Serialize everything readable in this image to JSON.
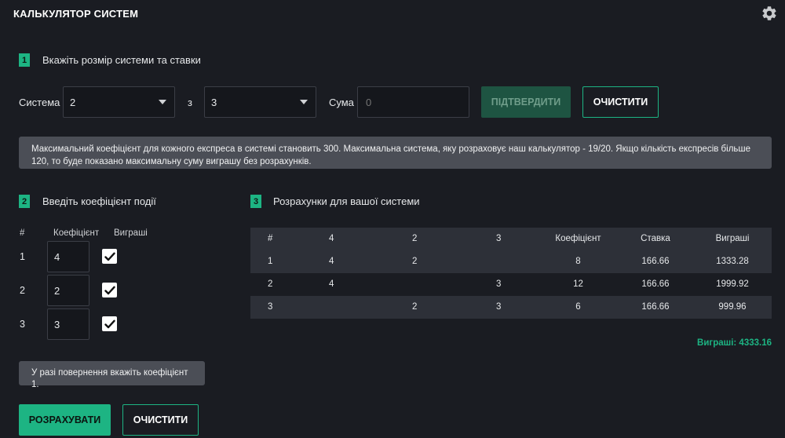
{
  "header": {
    "title": "КАЛЬКУЛЯТОР СИСТЕМ",
    "settings_icon": "gear-icon"
  },
  "step1": {
    "number": "1",
    "label": "Вкажіть розмір системи та ставки",
    "system_label": "Система",
    "system_value": "2",
    "of_label": "з",
    "of_value": "3",
    "sum_label": "Сума",
    "sum_placeholder": "0",
    "confirm_label": "ПІДТВЕРДИТИ",
    "clear_label": "ОЧИСТИТИ"
  },
  "info_note": "Максимальний коефіцієнт для кожного експреса в системі становить 300. Максимальна система, яку розраховує наш калькулятор - 19/20. Якщо кількість експресів більше 120, то буде показано максимальну суму виграшу без розрахунків.",
  "step2": {
    "number": "2",
    "label": "Введіть коефіцієнт події",
    "columns": {
      "num": "#",
      "coef": "Коефіцієнт",
      "wins": "Виграші"
    },
    "rows": [
      {
        "num": "1",
        "coef": "4",
        "checked": true
      },
      {
        "num": "2",
        "coef": "2",
        "checked": true
      },
      {
        "num": "3",
        "coef": "3",
        "checked": true
      }
    ],
    "return_note": "У разі повернення вкажіть коефіцієнт 1.",
    "calculate_label": "РОЗРАХУВАТИ",
    "clear_label": "ОЧИСТИТИ"
  },
  "step3": {
    "number": "3",
    "label": "Розрахунки для вашої системи",
    "table": {
      "headers": [
        "#",
        "4",
        "2",
        "3",
        "Коефіцієнт",
        "Ставка",
        "Виграші"
      ],
      "rows": [
        [
          "1",
          "4",
          "2",
          "",
          "8",
          "166.66",
          "1333.28"
        ],
        [
          "2",
          "4",
          "",
          "3",
          "12",
          "166.66",
          "1999.92"
        ],
        [
          "3",
          "",
          "2",
          "3",
          "6",
          "166.66",
          "999.96"
        ]
      ]
    },
    "total_label": "Виграші: 4333.16"
  },
  "colors": {
    "accent": "#1db483",
    "background": "#1a1c22",
    "note_bg": "#4b4e56"
  }
}
